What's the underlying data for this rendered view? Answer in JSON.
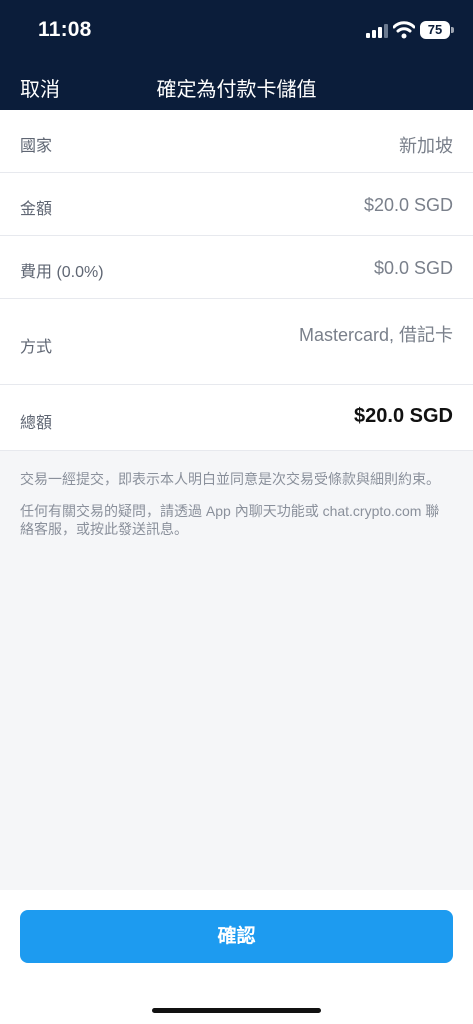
{
  "status_bar": {
    "time": "11:08",
    "battery": "75"
  },
  "nav": {
    "cancel": "取消",
    "title": "確定為付款卡儲值"
  },
  "rows": [
    {
      "label": "國家",
      "value": "新加坡"
    },
    {
      "label": "金額",
      "value": "$20.0 SGD"
    },
    {
      "label": "費用 (0.0%)",
      "value": "$0.0 SGD"
    },
    {
      "label": "方式",
      "value": "Mastercard, 借記卡"
    },
    {
      "label": "總額",
      "value": "$20.0 SGD"
    }
  ],
  "notes": [
    "交易一經提交，即表示本人明白並同意是次交易受條款與細則約束。",
    "任何有關交易的疑問，請透過 App 內聊天功能或 chat.crypto.com 聯絡客服，或按此發送訊息。"
  ],
  "confirm_label": "確認",
  "colors": {
    "header": "#0b1d3a",
    "accent": "#1d9bf0"
  },
  "icons": [
    "signal-icon",
    "wifi-icon",
    "battery-icon"
  ]
}
